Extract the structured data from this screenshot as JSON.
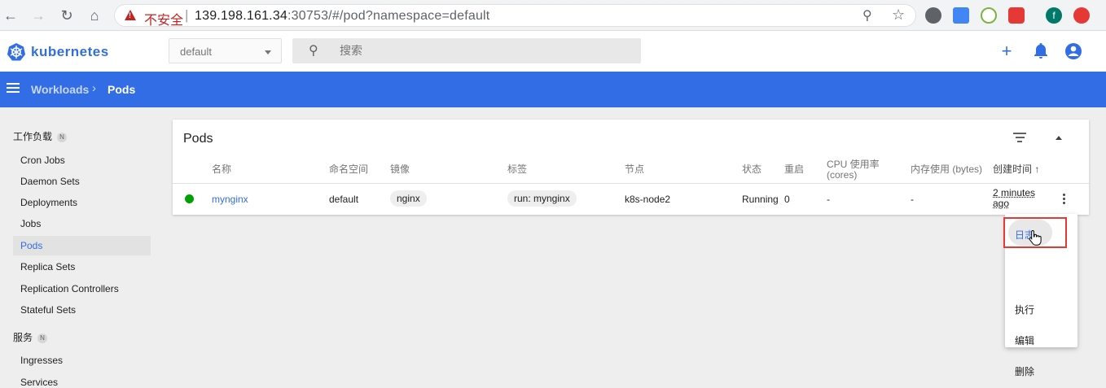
{
  "browser": {
    "insecure_label": "不安全",
    "url_host": "139.198.161.34",
    "url_rest": ":30753/#/pod?namespace=default",
    "extension_avatar_letter": "f"
  },
  "header": {
    "logo_text": "kubernetes",
    "namespace": "default",
    "search_placeholder": "搜索"
  },
  "toolbar": {
    "breadcrumb_parent": "Workloads",
    "breadcrumb_current": "Pods"
  },
  "sidebar": {
    "sections": [
      {
        "label": "工作负载",
        "badge": "N"
      },
      {
        "label": "服务",
        "badge": "N"
      }
    ],
    "items": [
      {
        "label": "Cron Jobs"
      },
      {
        "label": "Daemon Sets"
      },
      {
        "label": "Deployments"
      },
      {
        "label": "Jobs"
      },
      {
        "label": "Pods"
      },
      {
        "label": "Replica Sets"
      },
      {
        "label": "Replication Controllers"
      },
      {
        "label": "Stateful Sets"
      },
      {
        "label": "Ingresses"
      },
      {
        "label": "Services"
      }
    ]
  },
  "card": {
    "title": "Pods",
    "columns": [
      "名称",
      "命名空间",
      "镜像",
      "标签",
      "节点",
      "状态",
      "重启",
      "CPU 使用率",
      "(cores)",
      "内存使用 (bytes)",
      "创建时间",
      "↑"
    ],
    "row": {
      "name": "mynginx",
      "namespace": "default",
      "image": "nginx",
      "label": "run: mynginx",
      "node": "k8s-node2",
      "status": "Running",
      "restarts": "0",
      "cpu": "-",
      "memory": "-",
      "created_line1": "2 minutes",
      "created_line2": "ago"
    }
  },
  "menu": {
    "items": [
      "日志",
      "执行",
      "编辑",
      "删除"
    ]
  },
  "colors": {
    "brand": "#326de6",
    "running": "#00a000",
    "highlight": "#e53935"
  }
}
